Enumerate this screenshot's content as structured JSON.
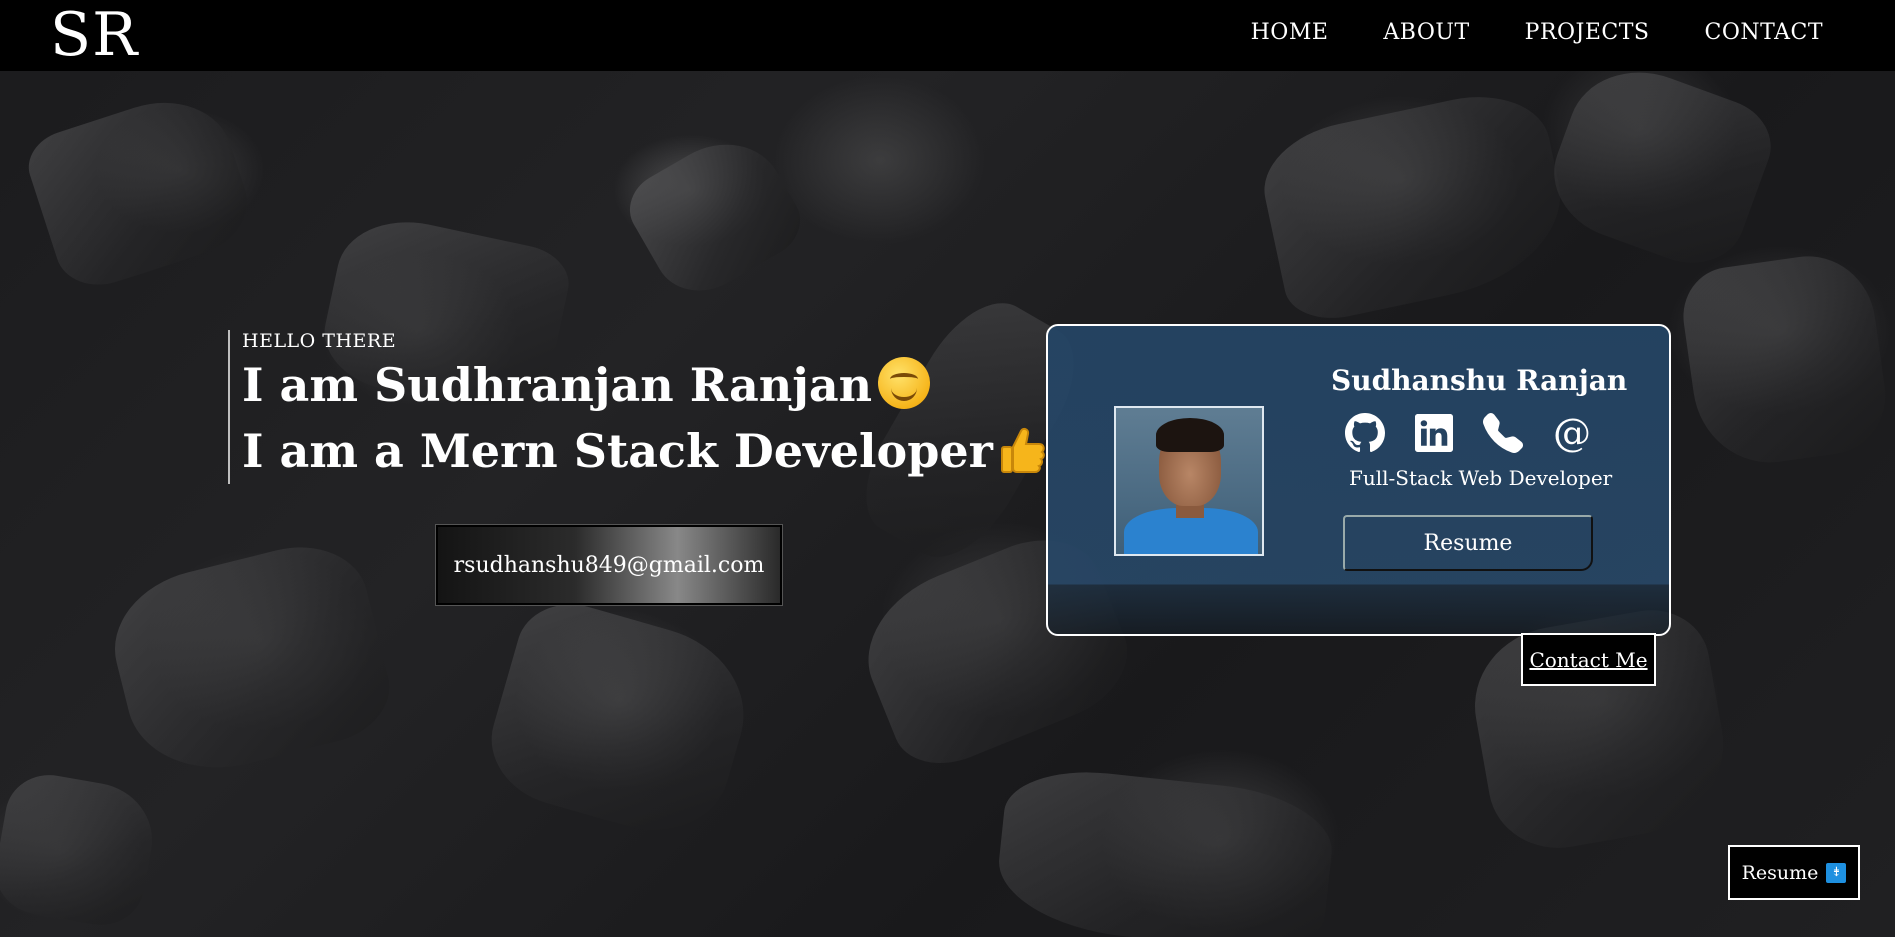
{
  "nav": {
    "logo": "SR",
    "links": [
      "HOME",
      "ABOUT",
      "PROJECTS",
      "CONTACT"
    ]
  },
  "intro": {
    "greeting": "HELLO THERE",
    "line1": "I am Sudhranjan Ranjan",
    "line2": "I am a Mern Stack Developer",
    "email": "rsudhanshu849@gmail.com"
  },
  "card": {
    "name": "Sudhanshu Ranjan",
    "role": "Full-Stack Web Developer",
    "resume_label": "Resume",
    "icons": [
      "github-icon",
      "linkedin-icon",
      "phone-icon",
      "at-icon"
    ],
    "at_symbol": "@"
  },
  "contact_button": "Contact Me",
  "floating_resume": {
    "label": "Resume",
    "icon": "download-icon"
  },
  "colors": {
    "nav_bg": "#000000",
    "card_bg": "#244566",
    "download_icon": "#1e90e0",
    "emoji": "#f6b51b"
  }
}
